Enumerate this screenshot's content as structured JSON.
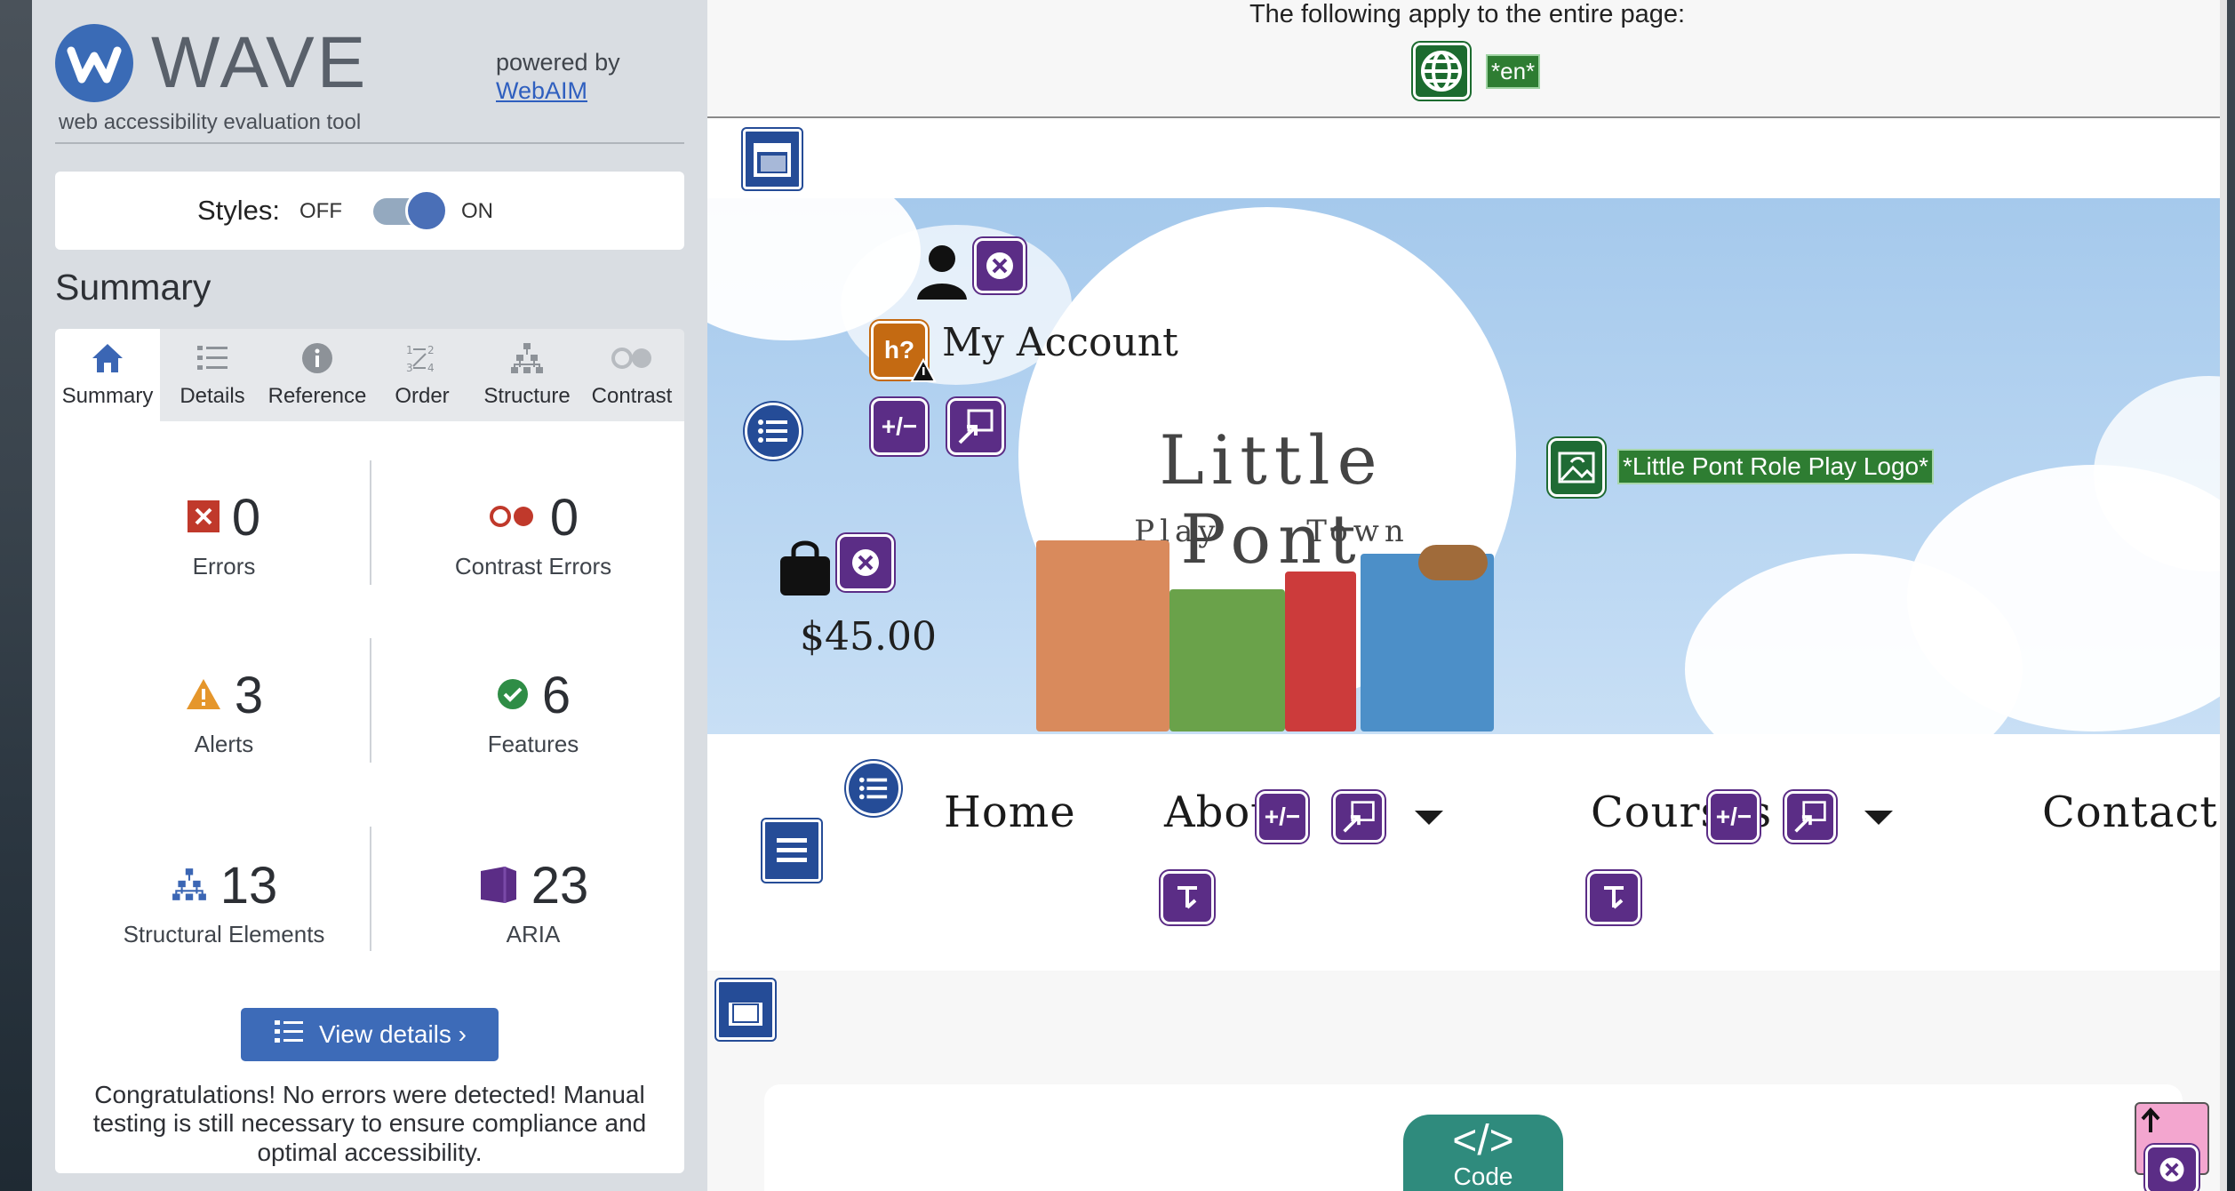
{
  "wave": {
    "logo_text": "WAVE",
    "subtitle": "web accessibility evaluation tool",
    "powered_by": "powered by",
    "webaim_link": "WebAIM",
    "styles_label": "Styles:",
    "styles_off": "OFF",
    "styles_on": "ON",
    "styles_toggle_on": true,
    "summary_heading": "Summary",
    "tabs": [
      {
        "label": "Summary",
        "icon": "home-icon",
        "active": true
      },
      {
        "label": "Details",
        "icon": "list-icon",
        "active": false
      },
      {
        "label": "Reference",
        "icon": "info-icon",
        "active": false
      },
      {
        "label": "Order",
        "icon": "order-icon",
        "active": false
      },
      {
        "label": "Structure",
        "icon": "structure-icon",
        "active": false
      },
      {
        "label": "Contrast",
        "icon": "contrast-icon",
        "active": false
      }
    ],
    "stats": {
      "errors": {
        "value": "0",
        "label": "Errors"
      },
      "contrast_errors": {
        "value": "0",
        "label": "Contrast Errors"
      },
      "alerts": {
        "value": "3",
        "label": "Alerts"
      },
      "features": {
        "value": "6",
        "label": "Features"
      },
      "structural": {
        "value": "13",
        "label": "Structural Elements"
      },
      "aria": {
        "value": "23",
        "label": "ARIA"
      }
    },
    "view_details": "View details ›",
    "congrats": "Congratulations! No errors were detected! Manual testing is still necessary to ensure compliance and optimal accessibility."
  },
  "page": {
    "entire_page_note": "The following apply to the entire page:",
    "lang_tag": "*en*",
    "my_account": "My Account",
    "logo_alt_tag": "*Little Pont Role Play Logo*",
    "logo_title": "Little Pont",
    "logo_subtitle": "Play Town",
    "cart_total": "$45.00",
    "nav": {
      "home": "Home",
      "about": "About",
      "courses": "Courses",
      "contact": "Contact"
    },
    "code_badge": "Code"
  },
  "colors": {
    "wave_blue": "#3a6bb6",
    "aria_purple": "#5b2d86",
    "feature_green": "#1f6b34",
    "alert_orange": "#c46a12",
    "error_red": "#c0392b"
  }
}
